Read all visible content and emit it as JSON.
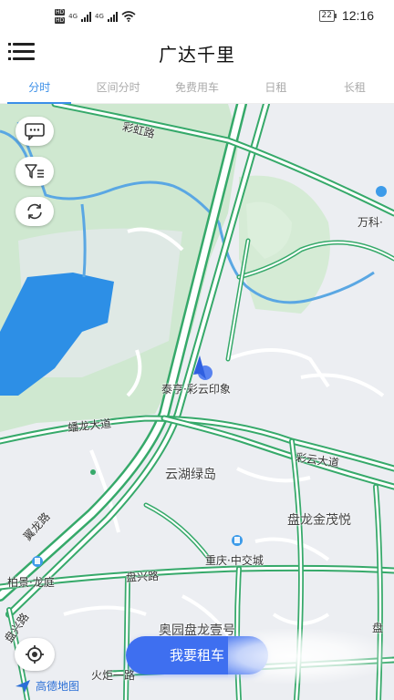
{
  "status_bar": {
    "hd1": "HD",
    "hd2": "HD",
    "sig1": "4G",
    "sig2": "4G",
    "battery": "22",
    "time": "12:16"
  },
  "header": {
    "title": "广达千里"
  },
  "tabs": [
    {
      "label": "分时",
      "active": true
    },
    {
      "label": "区间分时",
      "active": false
    },
    {
      "label": "免费用车",
      "active": false
    },
    {
      "label": "日租",
      "active": false
    },
    {
      "label": "长租",
      "active": false
    }
  ],
  "map": {
    "road_labels": {
      "caihong": "彩虹路",
      "panlong_dadao": "蟠龙大道",
      "caiyun_dadao": "彩云大道",
      "xianglong": "翼龙路",
      "panxing": "盘兴路",
      "panxing2": "盘兴路",
      "huoju": "火炬一路"
    },
    "poi_labels": {
      "taiting": "泰亨·彩云印象",
      "yunhu": "云湖绿岛",
      "panlong_jinmao": "盘龙金茂悦",
      "chongqing": "重庆·中交城",
      "baijing": "柏景·龙庭",
      "aoyuan": "奥园盘龙壹号",
      "wanke": "万科·",
      "pan_edge": "盘"
    },
    "colors": {
      "road_green": "#36a96a",
      "water": "#2d8fe6",
      "park": "#cfe8d0",
      "ground": "#eceef2",
      "accent": "#3e6ff0"
    }
  },
  "controls": {
    "rent_button": "我要租车",
    "map_logo": "高德地图"
  }
}
